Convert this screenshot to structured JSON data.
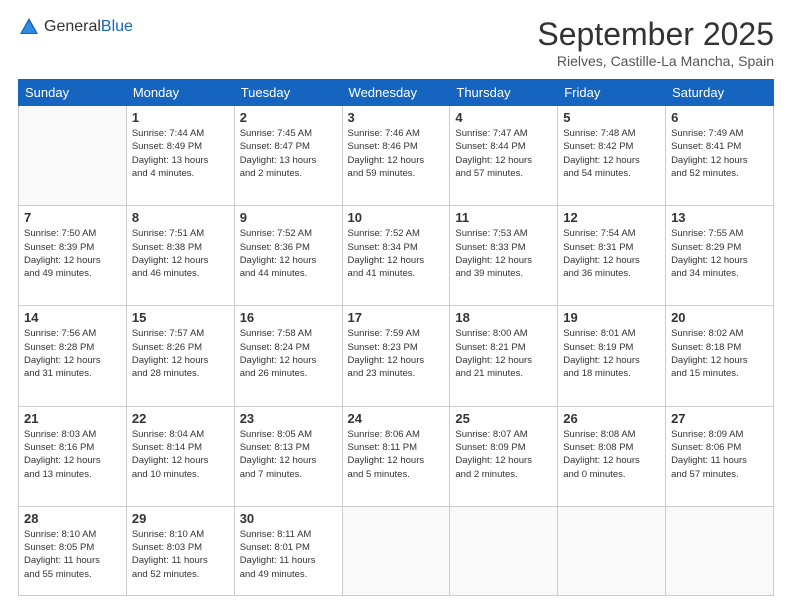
{
  "logo": {
    "general": "General",
    "blue": "Blue"
  },
  "header": {
    "title": "September 2025",
    "subtitle": "Rielves, Castille-La Mancha, Spain"
  },
  "weekdays": [
    "Sunday",
    "Monday",
    "Tuesday",
    "Wednesday",
    "Thursday",
    "Friday",
    "Saturday"
  ],
  "weeks": [
    [
      {
        "day": "",
        "info": ""
      },
      {
        "day": "1",
        "info": "Sunrise: 7:44 AM\nSunset: 8:49 PM\nDaylight: 13 hours\nand 4 minutes."
      },
      {
        "day": "2",
        "info": "Sunrise: 7:45 AM\nSunset: 8:47 PM\nDaylight: 13 hours\nand 2 minutes."
      },
      {
        "day": "3",
        "info": "Sunrise: 7:46 AM\nSunset: 8:46 PM\nDaylight: 12 hours\nand 59 minutes."
      },
      {
        "day": "4",
        "info": "Sunrise: 7:47 AM\nSunset: 8:44 PM\nDaylight: 12 hours\nand 57 minutes."
      },
      {
        "day": "5",
        "info": "Sunrise: 7:48 AM\nSunset: 8:42 PM\nDaylight: 12 hours\nand 54 minutes."
      },
      {
        "day": "6",
        "info": "Sunrise: 7:49 AM\nSunset: 8:41 PM\nDaylight: 12 hours\nand 52 minutes."
      }
    ],
    [
      {
        "day": "7",
        "info": "Sunrise: 7:50 AM\nSunset: 8:39 PM\nDaylight: 12 hours\nand 49 minutes."
      },
      {
        "day": "8",
        "info": "Sunrise: 7:51 AM\nSunset: 8:38 PM\nDaylight: 12 hours\nand 46 minutes."
      },
      {
        "day": "9",
        "info": "Sunrise: 7:52 AM\nSunset: 8:36 PM\nDaylight: 12 hours\nand 44 minutes."
      },
      {
        "day": "10",
        "info": "Sunrise: 7:52 AM\nSunset: 8:34 PM\nDaylight: 12 hours\nand 41 minutes."
      },
      {
        "day": "11",
        "info": "Sunrise: 7:53 AM\nSunset: 8:33 PM\nDaylight: 12 hours\nand 39 minutes."
      },
      {
        "day": "12",
        "info": "Sunrise: 7:54 AM\nSunset: 8:31 PM\nDaylight: 12 hours\nand 36 minutes."
      },
      {
        "day": "13",
        "info": "Sunrise: 7:55 AM\nSunset: 8:29 PM\nDaylight: 12 hours\nand 34 minutes."
      }
    ],
    [
      {
        "day": "14",
        "info": "Sunrise: 7:56 AM\nSunset: 8:28 PM\nDaylight: 12 hours\nand 31 minutes."
      },
      {
        "day": "15",
        "info": "Sunrise: 7:57 AM\nSunset: 8:26 PM\nDaylight: 12 hours\nand 28 minutes."
      },
      {
        "day": "16",
        "info": "Sunrise: 7:58 AM\nSunset: 8:24 PM\nDaylight: 12 hours\nand 26 minutes."
      },
      {
        "day": "17",
        "info": "Sunrise: 7:59 AM\nSunset: 8:23 PM\nDaylight: 12 hours\nand 23 minutes."
      },
      {
        "day": "18",
        "info": "Sunrise: 8:00 AM\nSunset: 8:21 PM\nDaylight: 12 hours\nand 21 minutes."
      },
      {
        "day": "19",
        "info": "Sunrise: 8:01 AM\nSunset: 8:19 PM\nDaylight: 12 hours\nand 18 minutes."
      },
      {
        "day": "20",
        "info": "Sunrise: 8:02 AM\nSunset: 8:18 PM\nDaylight: 12 hours\nand 15 minutes."
      }
    ],
    [
      {
        "day": "21",
        "info": "Sunrise: 8:03 AM\nSunset: 8:16 PM\nDaylight: 12 hours\nand 13 minutes."
      },
      {
        "day": "22",
        "info": "Sunrise: 8:04 AM\nSunset: 8:14 PM\nDaylight: 12 hours\nand 10 minutes."
      },
      {
        "day": "23",
        "info": "Sunrise: 8:05 AM\nSunset: 8:13 PM\nDaylight: 12 hours\nand 7 minutes."
      },
      {
        "day": "24",
        "info": "Sunrise: 8:06 AM\nSunset: 8:11 PM\nDaylight: 12 hours\nand 5 minutes."
      },
      {
        "day": "25",
        "info": "Sunrise: 8:07 AM\nSunset: 8:09 PM\nDaylight: 12 hours\nand 2 minutes."
      },
      {
        "day": "26",
        "info": "Sunrise: 8:08 AM\nSunset: 8:08 PM\nDaylight: 12 hours\nand 0 minutes."
      },
      {
        "day": "27",
        "info": "Sunrise: 8:09 AM\nSunset: 8:06 PM\nDaylight: 11 hours\nand 57 minutes."
      }
    ],
    [
      {
        "day": "28",
        "info": "Sunrise: 8:10 AM\nSunset: 8:05 PM\nDaylight: 11 hours\nand 55 minutes."
      },
      {
        "day": "29",
        "info": "Sunrise: 8:10 AM\nSunset: 8:03 PM\nDaylight: 11 hours\nand 52 minutes."
      },
      {
        "day": "30",
        "info": "Sunrise: 8:11 AM\nSunset: 8:01 PM\nDaylight: 11 hours\nand 49 minutes."
      },
      {
        "day": "",
        "info": ""
      },
      {
        "day": "",
        "info": ""
      },
      {
        "day": "",
        "info": ""
      },
      {
        "day": "",
        "info": ""
      }
    ]
  ]
}
